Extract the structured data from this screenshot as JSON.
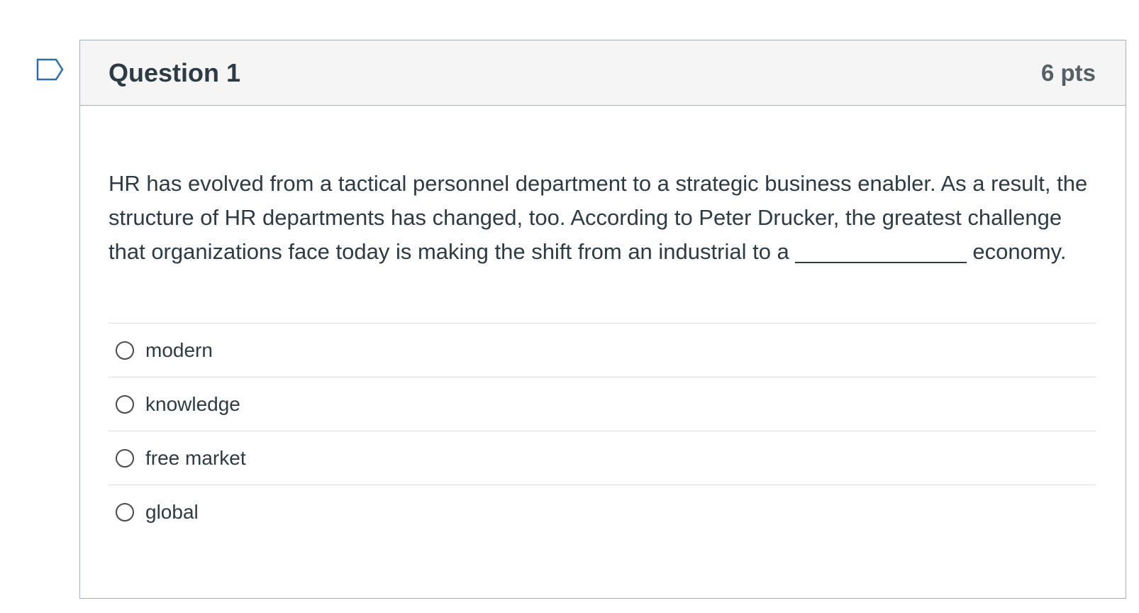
{
  "question": {
    "title": "Question 1",
    "points": "6 pts",
    "text": "HR has evolved from a tactical personnel department to a strategic business enabler. As a result, the structure of HR departments has changed, too. According to Peter Drucker, the greatest challenge that organizations face today is making the shift from an industrial to a ______________ economy.",
    "flag_icon": "flag-outline-icon"
  },
  "answers": [
    {
      "label": "modern",
      "selected": false
    },
    {
      "label": "knowledge",
      "selected": false
    },
    {
      "label": "free market",
      "selected": false
    },
    {
      "label": "global",
      "selected": false
    }
  ],
  "colors": {
    "text": "#2d3b45",
    "border": "#a5afb5",
    "header_bg": "#f5f5f5",
    "flag": "#2d6ea8"
  }
}
